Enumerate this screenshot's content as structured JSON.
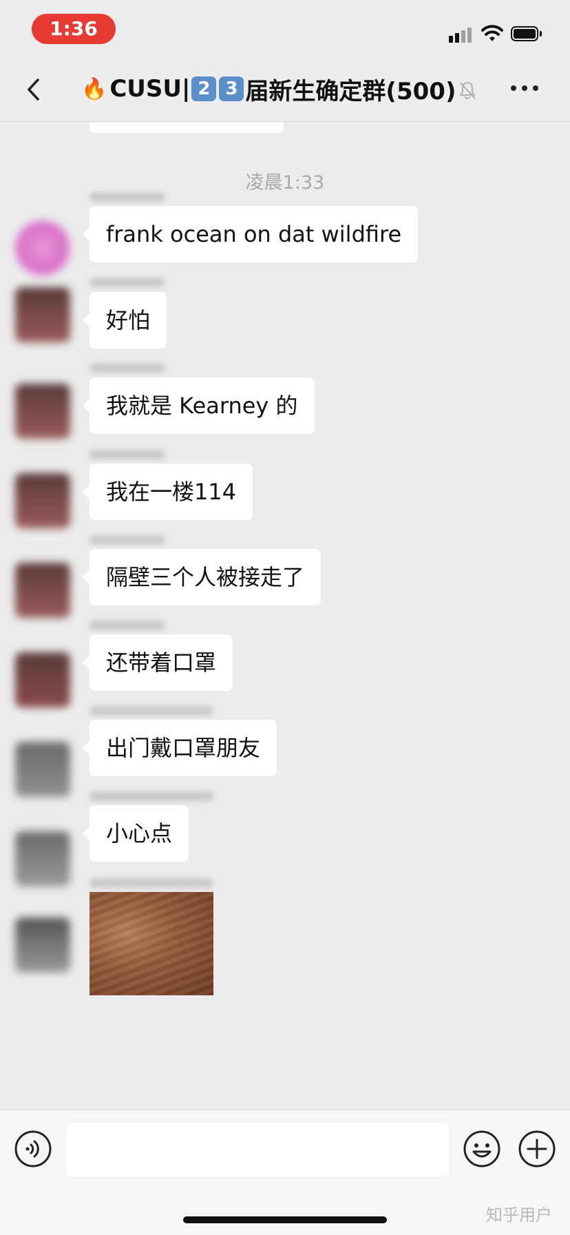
{
  "status_bar": {
    "time": "1:36",
    "time_pill_color": "#e63b33"
  },
  "nav": {
    "back_icon": "chevron-left-icon",
    "fire_emoji": "🔥",
    "title_prefix": "CUSU|",
    "badge_1": "2",
    "badge_2": "3",
    "title_suffix": "届新生确定群(500)",
    "mute_icon": "bell-slash-icon",
    "more_icon": "ellipsis-icon"
  },
  "chat": {
    "timestamp": "凌晨1:33",
    "messages": [
      {
        "text": "frank ocean on dat wildfire"
      },
      {
        "text": "好怕"
      },
      {
        "text": "我就是 Kearney 的"
      },
      {
        "text": "我在一楼114"
      },
      {
        "text": "隔壁三个人被接走了"
      },
      {
        "text": "还带着口罩"
      },
      {
        "text": "出门戴口罩朋友"
      },
      {
        "text": "小心点"
      }
    ],
    "image_message": "photo-thumbnail"
  },
  "input_bar": {
    "voice_icon": "voice-icon",
    "input_value": "",
    "emoji_icon": "smiley-icon",
    "plus_icon": "plus-icon"
  },
  "watermark": "知乎用户"
}
